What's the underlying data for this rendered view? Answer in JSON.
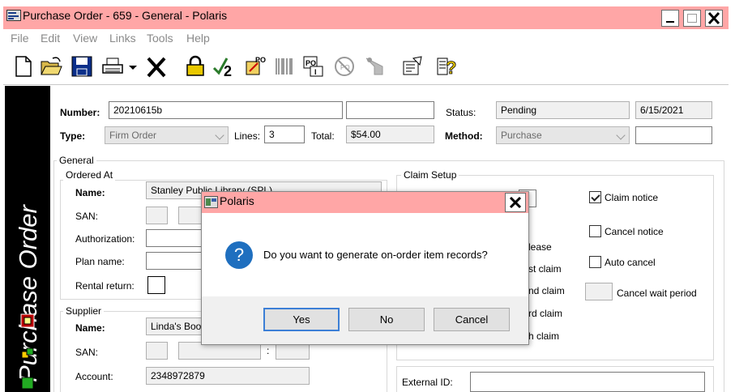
{
  "window": {
    "title": "Purchase Order - 659 - General - Polaris"
  },
  "menu": [
    "File",
    "Edit",
    "View",
    "Links",
    "Tools",
    "Help"
  ],
  "toolbar": {
    "icons": [
      "new-icon",
      "open-icon",
      "save-icon",
      "print-icon",
      "print-dropdown-icon",
      "delete-icon",
      "lock-icon",
      "check-icon",
      "release-po-icon",
      "barcode-icon",
      "po-invoice-icon",
      "cancel-po-icon",
      "receive-icon",
      "properties-icon",
      "help-icon"
    ]
  },
  "side_banner": {
    "text": "Purchase Order"
  },
  "header": {
    "number_label": "Number:",
    "number_value": "20210615b",
    "number_extra": "",
    "status_label": "Status:",
    "status_value": "Pending",
    "status_date": "6/15/2021",
    "type_label": "Type:",
    "type_value": "Firm Order",
    "lines_label": "Lines:",
    "lines_value": "3",
    "total_label": "Total:",
    "total_value": "$54.00",
    "method_label": "Method:",
    "method_value": "Purchase",
    "method_extra": ""
  },
  "general": {
    "title": "General",
    "ordered_at": {
      "title": "Ordered At",
      "name_label": "Name:",
      "name_value": "Stanley Public Library (SPL)",
      "san_label": "SAN:",
      "authorization_label": "Authorization:",
      "plan_name_label": "Plan name:",
      "rental_return_label": "Rental return:"
    },
    "supplier": {
      "title": "Supplier",
      "name_label": "Name:",
      "name_value": "Linda's Books",
      "san_label": "SAN:",
      "san_separator": ":",
      "account_label": "Account:",
      "account_value": "2348972879"
    }
  },
  "claim_setup": {
    "title": "Claim Setup",
    "partial_labels": [
      "lease",
      "st claim",
      "nd claim",
      "rd claim",
      "h claim"
    ],
    "claim_notice_label": "Claim notice",
    "cancel_notice_label": "Cancel notice",
    "auto_cancel_label": "Auto cancel",
    "cancel_wait_period_label": "Cancel wait period",
    "claim_notice_checked": true,
    "cancel_notice_checked": false,
    "auto_cancel_checked": false
  },
  "external_id": {
    "label": "External ID:"
  },
  "dialog": {
    "title": "Polaris",
    "message": "Do you want to generate on-order item records?",
    "yes_label": "Yes",
    "no_label": "No",
    "cancel_label": "Cancel"
  },
  "colors": {
    "titlebar": "#ffa6a6",
    "banner": "#000000",
    "banner_text": "#ffffff",
    "question_icon": "#1f6fbf",
    "default_button_border": "#3c7fd6"
  }
}
